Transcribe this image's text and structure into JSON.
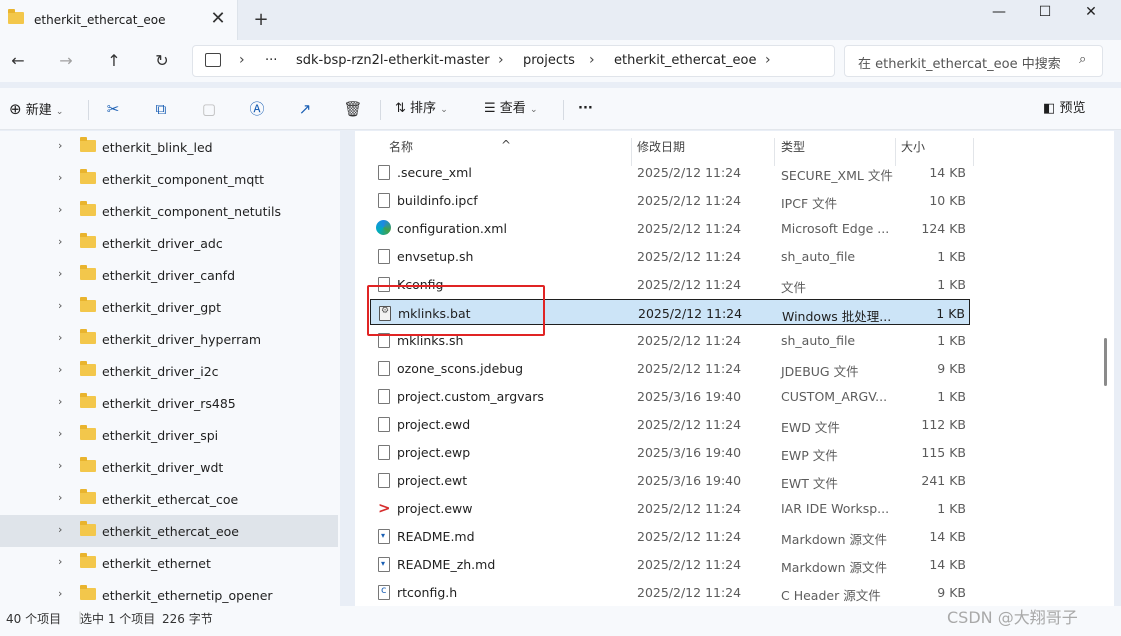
{
  "window": {
    "tab_title": "etherkit_ethercat_eoe",
    "tab_close": "✕",
    "new_tab": "+",
    "minimize": "—",
    "maximize": "☐",
    "close": "✕"
  },
  "nav": {
    "back": "←",
    "forward": "→",
    "up": "↑",
    "refresh": "↻",
    "breadcrumb": [
      "sdk-bsp-rzn2l-etherkit-master",
      "projects",
      "etherkit_ethercat_eoe"
    ],
    "more": "···",
    "sep": "›",
    "search_placeholder": "在 etherkit_ethercat_eoe 中搜索"
  },
  "toolbar": {
    "new_label": "新建",
    "sort_label": "排序",
    "view_label": "查看",
    "more": "···",
    "preview_label": "预览"
  },
  "sidebar": {
    "items": [
      {
        "label": "etherkit_blink_led"
      },
      {
        "label": "etherkit_component_mqtt"
      },
      {
        "label": "etherkit_component_netutils"
      },
      {
        "label": "etherkit_driver_adc"
      },
      {
        "label": "etherkit_driver_canfd"
      },
      {
        "label": "etherkit_driver_gpt"
      },
      {
        "label": "etherkit_driver_hyperram"
      },
      {
        "label": "etherkit_driver_i2c"
      },
      {
        "label": "etherkit_driver_rs485"
      },
      {
        "label": "etherkit_driver_spi"
      },
      {
        "label": "etherkit_driver_wdt"
      },
      {
        "label": "etherkit_ethercat_coe"
      },
      {
        "label": "etherkit_ethercat_eoe"
      },
      {
        "label": "etherkit_ethernet"
      },
      {
        "label": "etherkit_ethernetip_opener"
      }
    ],
    "chevron": "›"
  },
  "columns": {
    "name": "名称",
    "date": "修改日期",
    "type": "类型",
    "size": "大小"
  },
  "files": [
    {
      "name": ".secure_xml",
      "date": "2025/2/12 11:24",
      "type": "SECURE_XML 文件",
      "size": "14 KB",
      "icon": "file"
    },
    {
      "name": "buildinfo.ipcf",
      "date": "2025/2/12 11:24",
      "type": "IPCF 文件",
      "size": "10 KB",
      "icon": "file"
    },
    {
      "name": "configuration.xml",
      "date": "2025/2/12 11:24",
      "type": "Microsoft Edge ...",
      "size": "124 KB",
      "icon": "edge"
    },
    {
      "name": "envsetup.sh",
      "date": "2025/2/12 11:24",
      "type": "sh_auto_file",
      "size": "1 KB",
      "icon": "file"
    },
    {
      "name": "Kconfig",
      "date": "2025/2/12 11:24",
      "type": "文件",
      "size": "1 KB",
      "icon": "file"
    },
    {
      "name": "mklinks.bat",
      "date": "2025/2/12 11:24",
      "type": "Windows 批处理...",
      "size": "1 KB",
      "icon": "bat"
    },
    {
      "name": "mklinks.sh",
      "date": "2025/2/12 11:24",
      "type": "sh_auto_file",
      "size": "1 KB",
      "icon": "file"
    },
    {
      "name": "ozone_scons.jdebug",
      "date": "2025/2/12 11:24",
      "type": "JDEBUG 文件",
      "size": "9 KB",
      "icon": "file"
    },
    {
      "name": "project.custom_argvars",
      "date": "2025/3/16 19:40",
      "type": "CUSTOM_ARGV...",
      "size": "1 KB",
      "icon": "file"
    },
    {
      "name": "project.ewd",
      "date": "2025/2/12 11:24",
      "type": "EWD 文件",
      "size": "112 KB",
      "icon": "file"
    },
    {
      "name": "project.ewp",
      "date": "2025/3/16 19:40",
      "type": "EWP 文件",
      "size": "115 KB",
      "icon": "file"
    },
    {
      "name": "project.ewt",
      "date": "2025/3/16 19:40",
      "type": "EWT 文件",
      "size": "241 KB",
      "icon": "file"
    },
    {
      "name": "project.eww",
      "date": "2025/2/12 11:24",
      "type": "IAR IDE Worksp...",
      "size": "1 KB",
      "icon": "iar"
    },
    {
      "name": "README.md",
      "date": "2025/2/12 11:24",
      "type": "Markdown 源文件",
      "size": "14 KB",
      "icon": "md"
    },
    {
      "name": "README_zh.md",
      "date": "2025/2/12 11:24",
      "type": "Markdown 源文件",
      "size": "14 KB",
      "icon": "md"
    },
    {
      "name": "rtconfig.h",
      "date": "2025/2/12 11:24",
      "type": "C Header 源文件",
      "size": "9 KB",
      "icon": "h"
    }
  ],
  "status": {
    "count": "40 个项目",
    "selection": "选中 1 个项目",
    "size": "226 字节",
    "watermark": "CSDN @大翔哥子"
  }
}
